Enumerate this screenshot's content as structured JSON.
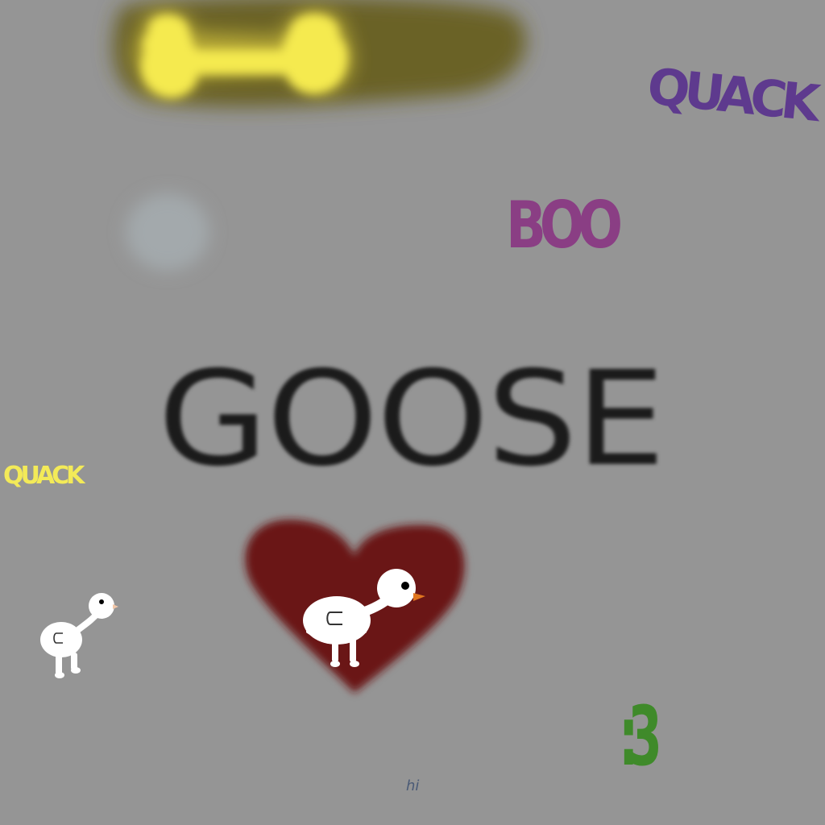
{
  "canvas": {
    "background_color": "#959595"
  },
  "texts": {
    "goose": "GOOSE",
    "quack_top": "QUACK",
    "quack_left": "QUACK",
    "boo": "BOO",
    "smiley": ":3",
    "hi": "hi"
  },
  "colors": {
    "bone_glow": "#f5ea4f",
    "olive_blob": "#6b6227",
    "gray_blob": "#a3a9ac",
    "heart": "#6b1617",
    "goose_white": "#ffffff",
    "goose_beak": "#e0761f",
    "quack_top": "#5e3a8e",
    "quack_left": "#f3ea58",
    "boo": "#8a3e84",
    "goose_text": "#1b1b1b",
    "smiley": "#3f8a2a",
    "hi": "#4a5a76"
  },
  "drawings": {
    "bone": "bone-icon",
    "heart": "heart-icon",
    "goose_in_heart": "goose-icon",
    "small_goose": "goose-icon",
    "gray_blob": "blob-icon",
    "olive_blob": "blob-icon"
  }
}
